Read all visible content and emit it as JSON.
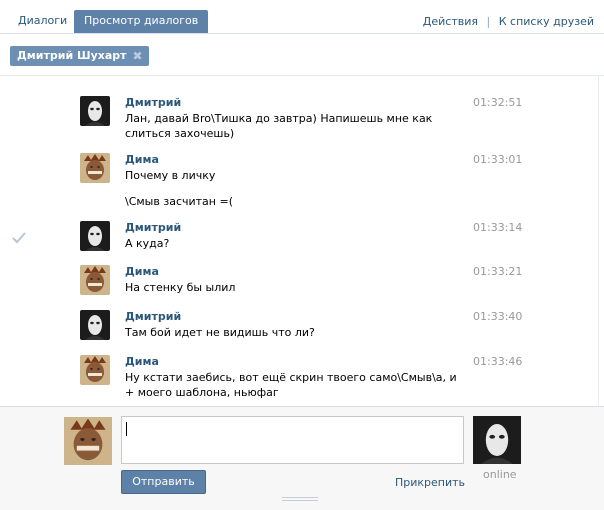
{
  "tabs": [
    {
      "label": "Диалоги"
    },
    {
      "label": "Просмотр диалогов"
    }
  ],
  "top_actions": {
    "actions": "Действия",
    "separator": "|",
    "back": "К списку друзей"
  },
  "chip": {
    "name": "Дмитрий Шухарт",
    "close_glyph": "✖"
  },
  "messages": [
    {
      "author": "Дмитрий",
      "time": "01:32:51",
      "text": "Лан, давай Bro\\Тишка до завтра) Напишешь мне как слиться захочешь)",
      "avatar": "white-mask-avatar"
    },
    {
      "author": "Дима",
      "time": "01:33:01",
      "text": "Почему в личку",
      "text2": "\\Смыв засчитан =(",
      "avatar": "crowned-face-avatar"
    },
    {
      "author": "Дмитрий",
      "time": "01:33:14",
      "text": "А куда?",
      "avatar": "white-mask-avatar",
      "read_check": true
    },
    {
      "author": "Дима",
      "time": "01:33:21",
      "text": "На стенку бы ылил",
      "avatar": "crowned-face-avatar"
    },
    {
      "author": "Дмитрий",
      "time": "01:33:40",
      "text": "Там бой идет не видишь что ли?",
      "avatar": "white-mask-avatar"
    },
    {
      "author": "Дима",
      "time": "01:33:46",
      "text": "Ну кстати заебись, вот ещё скрин твоего само\\Смыв\\а, и + моего шаблона, ньюфаг",
      "avatar": "crowned-face-avatar"
    }
  ],
  "composer": {
    "input_value": "",
    "send_label": "Отправить",
    "attach_label": "Прикрепить",
    "status": "online"
  },
  "colors": {
    "accent": "#5e81a8",
    "link": "#2b587a",
    "time": "#999999"
  }
}
